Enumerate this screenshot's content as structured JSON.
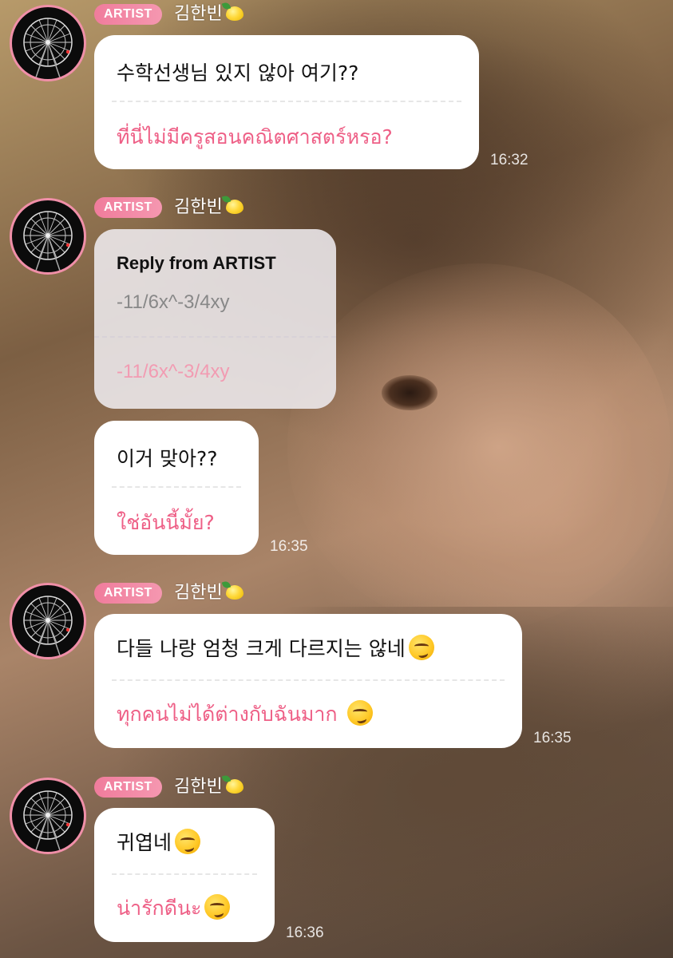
{
  "artist_tag": "ARTIST",
  "artist_name": "김한빈",
  "messages": [
    {
      "ko": "수학선생님 있지 않아 여기??",
      "th": "ที่นี่ไม่มีครูสอนคณิตศาสตร์หรอ?",
      "time": "16:32"
    },
    {
      "reply_title": "Reply from ARTIST",
      "ko": "-11/6x^-3/4xy",
      "th": "-11/6x^-3/4xy"
    },
    {
      "ko": "이거 맞아??",
      "th": "ใช่อันนี้มั้ย?",
      "time": "16:35"
    },
    {
      "ko": "다들 나랑 엄청 크게 다르지는 않네",
      "th": "ทุกคนไม่ได้ต่างกับฉันมาก",
      "time": "16:35"
    },
    {
      "ko": "귀엽네",
      "th": "น่ารักดีนะ",
      "time": "16:36"
    }
  ],
  "icons": {
    "avatar": "ferris-wheel-icon",
    "name_badge": "lemon-icon",
    "emoji": "smirk-emoji-icon"
  },
  "colors": {
    "accent_pink": "#ee5f86",
    "tag_pink": "#f07c9c",
    "bubble_bg": "#ffffff"
  }
}
